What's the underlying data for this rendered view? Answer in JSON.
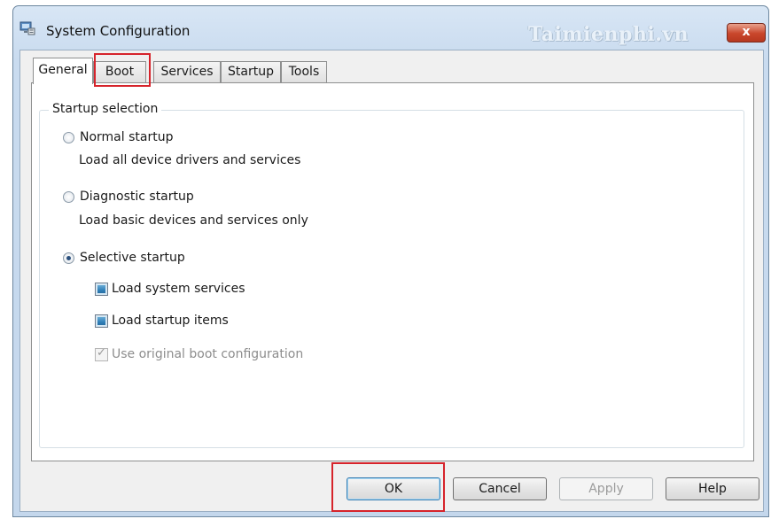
{
  "window": {
    "title": "System Configuration",
    "watermark": "Taimienphi.vn",
    "close_label": "x"
  },
  "tabs": [
    {
      "label": "General",
      "active": true
    },
    {
      "label": "Boot",
      "active": false
    },
    {
      "label": "Services",
      "active": false
    },
    {
      "label": "Startup",
      "active": false
    },
    {
      "label": "Tools",
      "active": false
    }
  ],
  "startup_selection": {
    "group_label": "Startup selection",
    "normal": {
      "label": "Normal startup",
      "description": "Load all device drivers and services",
      "selected": false
    },
    "diagnostic": {
      "label": "Diagnostic startup",
      "description": "Load basic devices and services only",
      "selected": false
    },
    "selective": {
      "label": "Selective startup",
      "selected": true,
      "options": [
        {
          "label": "Load system services",
          "checked": true,
          "enabled": true
        },
        {
          "label": "Load startup items",
          "checked": true,
          "enabled": true
        },
        {
          "label": "Use original boot configuration",
          "checked": true,
          "enabled": false
        }
      ]
    }
  },
  "buttons": {
    "ok": "OK",
    "cancel": "Cancel",
    "apply": "Apply",
    "help": "Help"
  },
  "colors": {
    "highlight": "#d6232b",
    "title_bar": "#c9dbef",
    "close_button": "#c9462b"
  }
}
